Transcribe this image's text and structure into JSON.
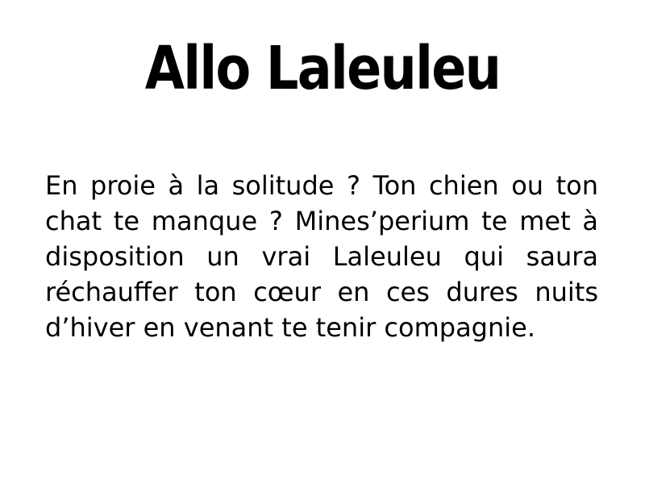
{
  "slide": {
    "title": "Allo Laleuleu",
    "body": "En proie à la solitude ? Ton chien ou ton chat te manque ? Mines’perium te met à disposition un vrai Laleuleu qui saura réchauffer ton cœur en ces dures nuits d’hiver en venant te tenir compagnie."
  },
  "colors": {
    "background": "#ffffff",
    "text": "#000000"
  }
}
